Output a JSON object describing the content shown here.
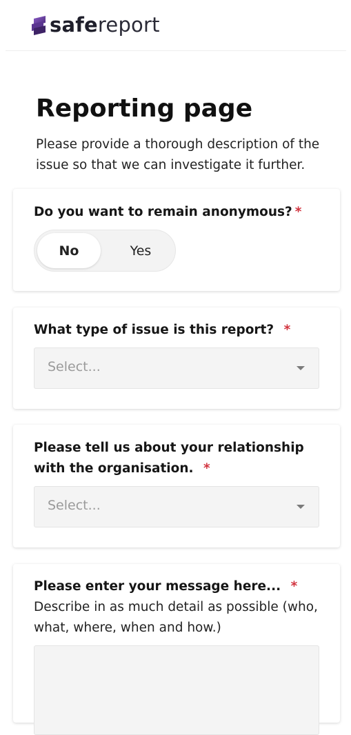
{
  "brand": {
    "name_bold": "safe",
    "name_light": "report",
    "logo_icon": "stacked-s-logo",
    "accent_color": "#6b3fa0"
  },
  "page": {
    "title": "Reporting page",
    "description": "Please provide a thorough description of the issue so that we can investigate it further."
  },
  "questions": {
    "anonymous": {
      "label": "Do you want to remain anonymous?",
      "required_mark": "*",
      "options": [
        "No",
        "Yes"
      ],
      "selected": "No"
    },
    "issue_type": {
      "label": "What type of issue is this report?",
      "required_mark": "*",
      "placeholder": "Select..."
    },
    "relationship": {
      "label": "Please tell us about your relationship with the organisation.",
      "required_mark": "*",
      "placeholder": "Select..."
    },
    "message": {
      "label": "Please enter your message here...",
      "required_mark": "*",
      "hint": "Describe in as much detail as possible (who, what, where, when and how.)",
      "value": ""
    }
  },
  "colors": {
    "required": "#d2343f",
    "field_bg": "#f4f4f4",
    "placeholder": "#9a9a9a"
  }
}
